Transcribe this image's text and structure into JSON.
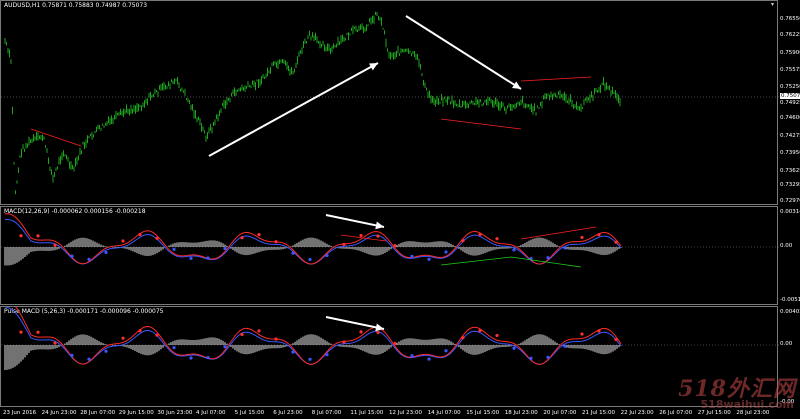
{
  "main_chart": {
    "label": "AUDUSD,H1  0.75871 0.75883 0.74987 0.75073",
    "price_ticks": [
      "0.76550",
      "0.76225",
      "0.75900",
      "0.75575",
      "0.75250",
      "0.74925",
      "0.74600",
      "0.74275",
      "0.73950",
      "0.73625",
      "0.73295",
      "0.72970"
    ],
    "current_price": "0.75073",
    "colors": {
      "bars": "#1fa31f",
      "arrows": "#ffffff",
      "trendlines": "#ff2020"
    }
  },
  "macd_panel": {
    "label": "MACD(12,26,9) -0.000062 0.000156 -0.000218",
    "ticks": [
      "0.003144",
      "0.00",
      "-0.00516"
    ]
  },
  "pulse_panel": {
    "label": "Pulse MACD (5,26,3) -0.000171 -0.000096 -0.000075",
    "ticks": [
      "0.004032",
      "0.00",
      "-0.00"
    ]
  },
  "time_axis": [
    "23 Jun 2016",
    "24 Jun 23:00",
    "28 Jun 07:00",
    "29 Jun 15:00",
    "30 Jun 23:00",
    "4 Jul 07:00",
    "5 Jul 15:00",
    "6 Jul 23:00",
    "8 Jul 07:00",
    "11 Jul 15:00",
    "12 Jul 23:00",
    "14 Jul 07:00",
    "15 Jul 15:00",
    "18 Jul 23:00",
    "20 Jul 07:00",
    "21 Jul 15:00",
    "22 Jul 23:00",
    "26 Jul 07:00",
    "27 Jul 15:00",
    "28 Jul 23:00"
  ],
  "watermark": {
    "line1": "518外汇网",
    "line2": "518waihui.com"
  }
}
